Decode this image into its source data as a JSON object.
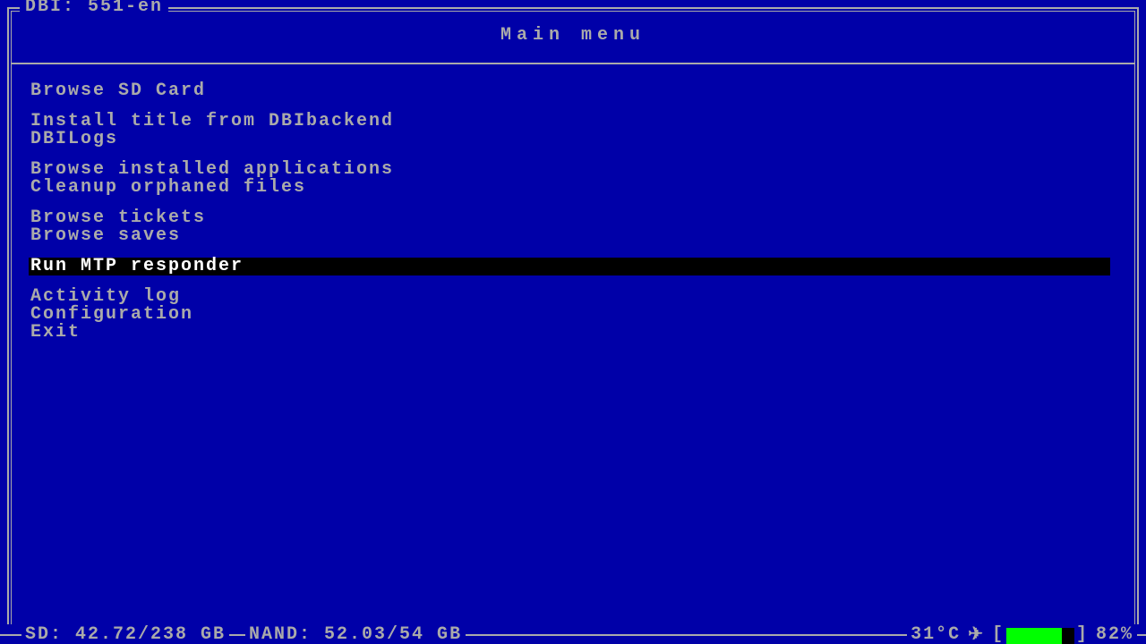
{
  "app_title": "DBI: 551-en",
  "heading": "Main menu",
  "menu": {
    "items": [
      {
        "label": "Browse SD Card"
      },
      {
        "label": "Install title from DBIbackend"
      },
      {
        "label": "DBILogs"
      },
      {
        "label": "Browse installed applications"
      },
      {
        "label": "Cleanup orphaned files"
      },
      {
        "label": "Browse tickets"
      },
      {
        "label": "Browse saves"
      },
      {
        "label": "Run MTP responder"
      },
      {
        "label": "Activity log"
      },
      {
        "label": "Configuration"
      },
      {
        "label": "Exit"
      }
    ],
    "selected_index": 7,
    "gaps_after": [
      0,
      2,
      4,
      6,
      7
    ]
  },
  "status": {
    "sd_label": "SD: 42.72/238 GB",
    "nand_label": "NAND: 52.03/54 GB",
    "temperature": "31°C",
    "airplane_icon": "✈",
    "battery_percent": 82,
    "battery_label": "82%"
  },
  "colors": {
    "bg": "#0000A8",
    "fg": "#AAAAAA",
    "sel_bg": "#000000",
    "sel_fg": "#FFFFFF",
    "batt": "#00FF00"
  }
}
